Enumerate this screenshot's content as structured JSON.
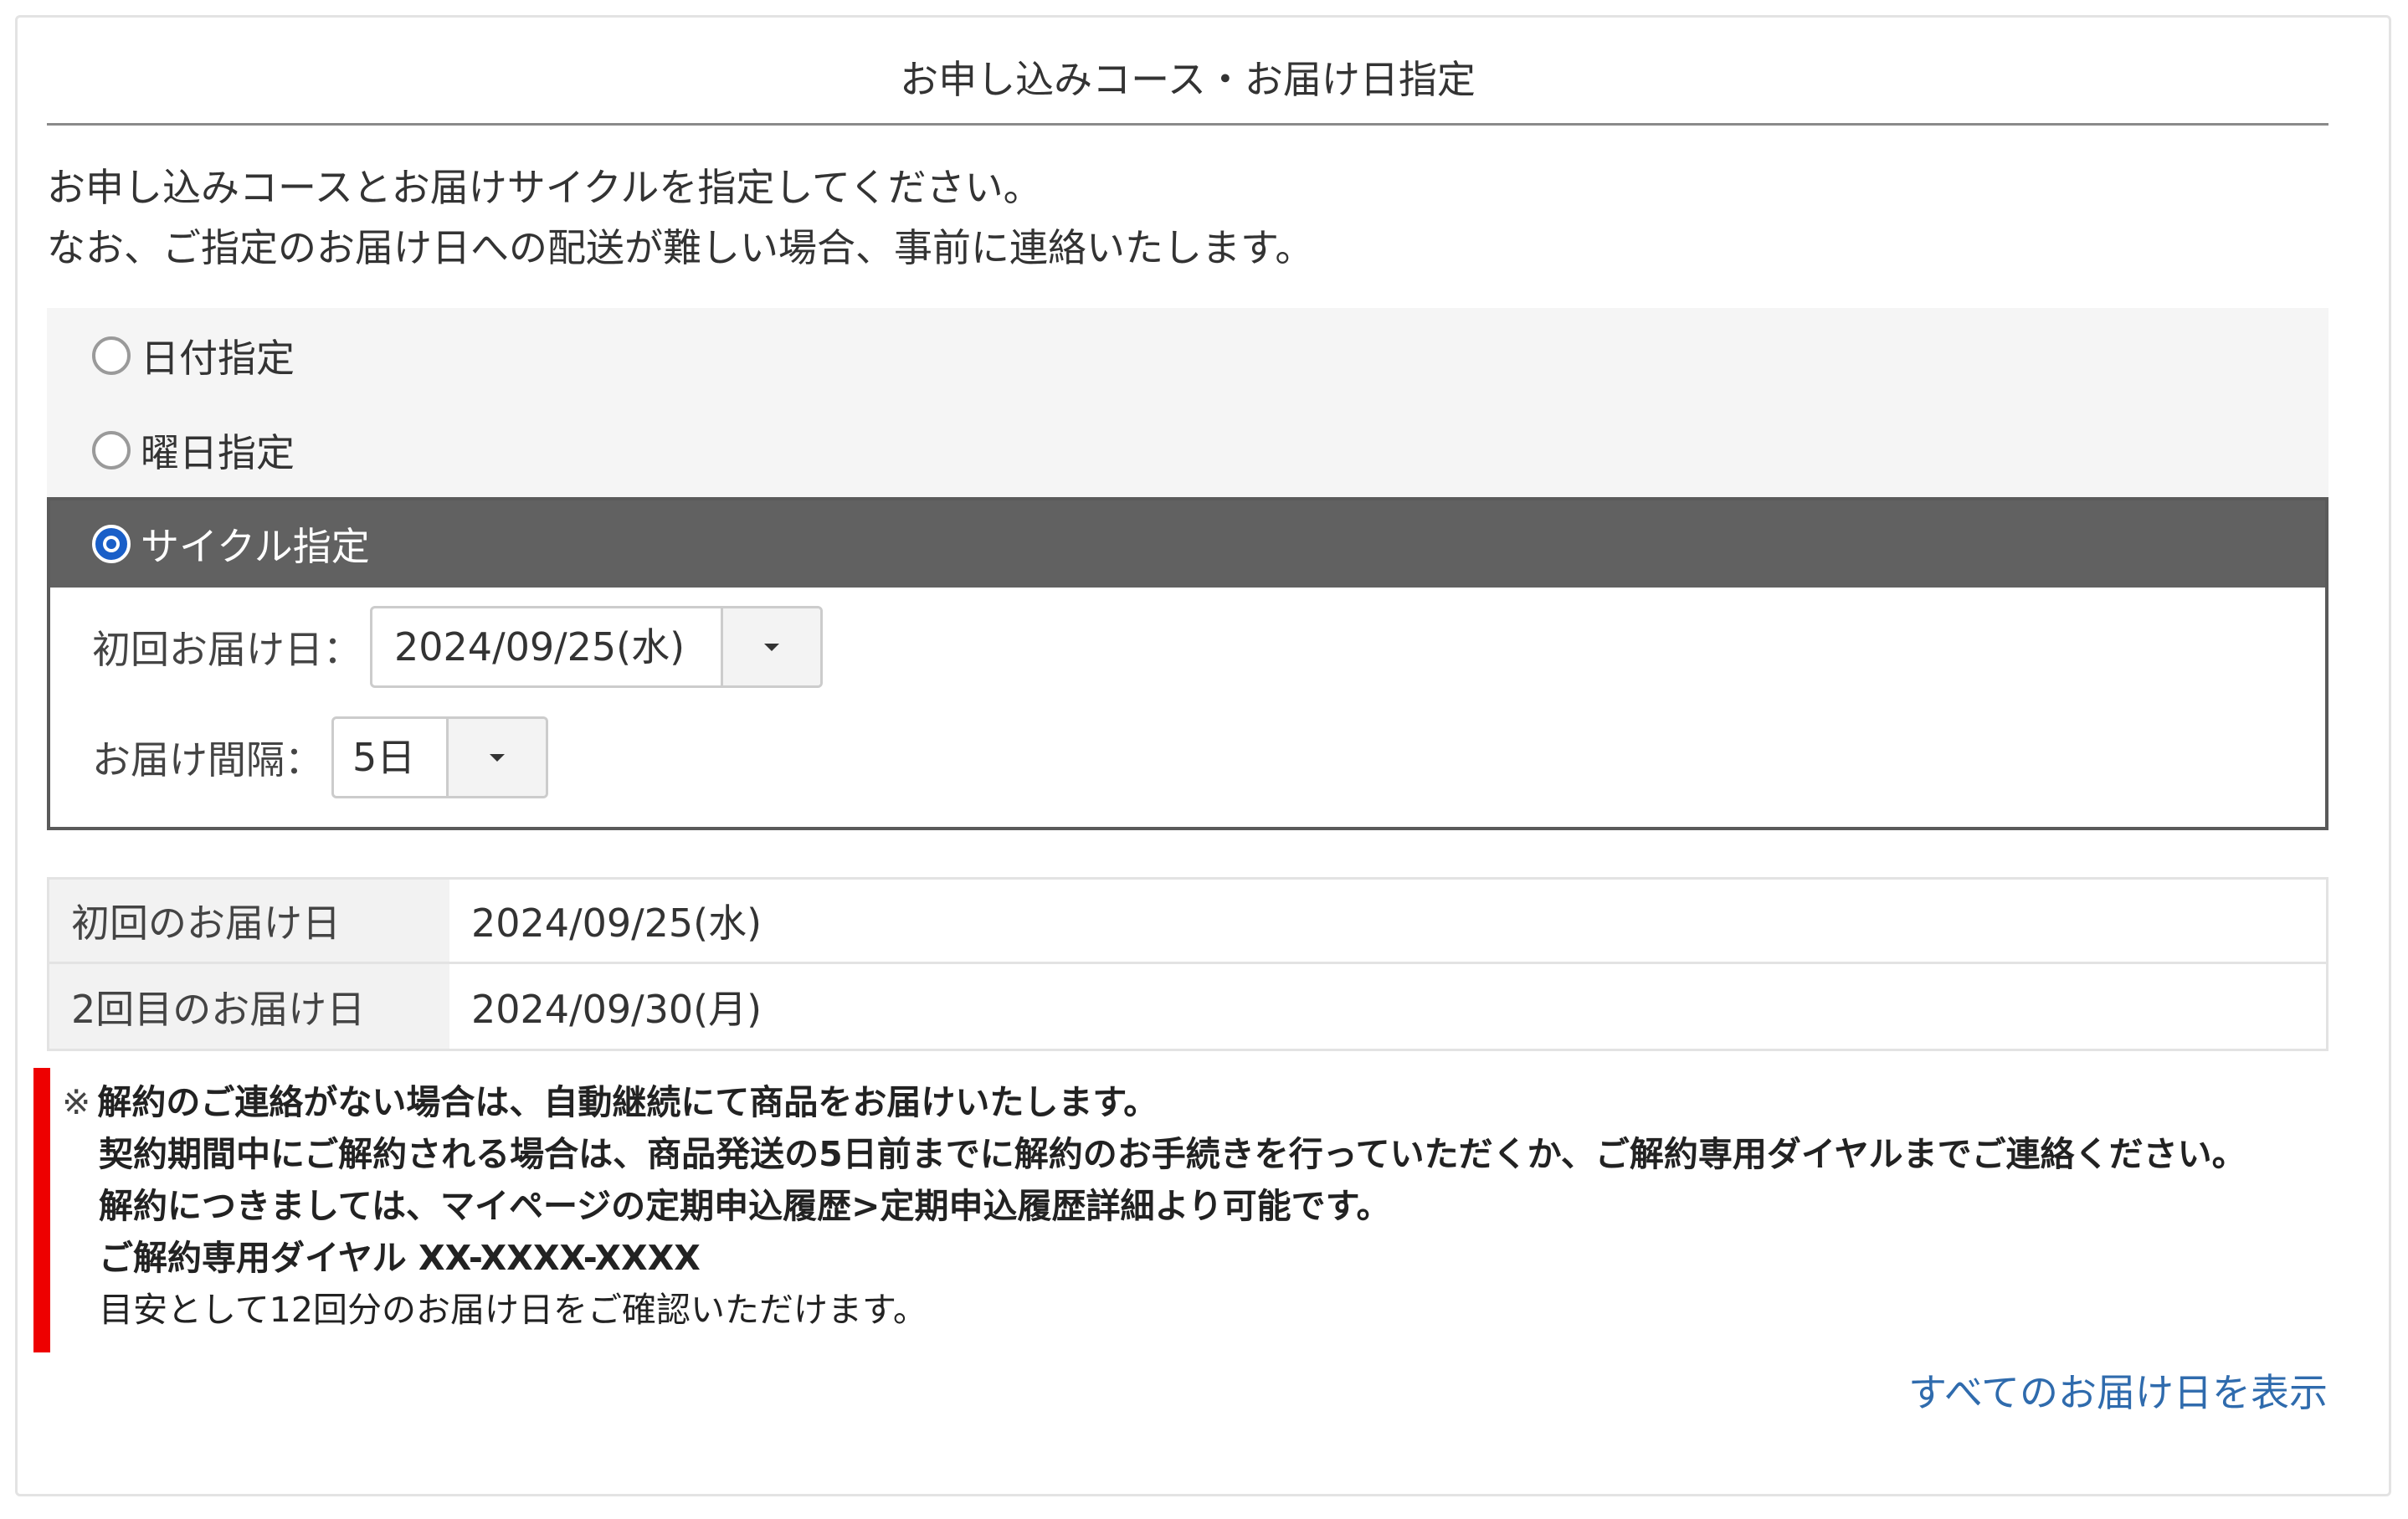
{
  "panel": {
    "title": "お申し込みコース・お届け日指定"
  },
  "intro": {
    "line1": "お申し込みコースとお届けサイクルを指定してください。",
    "line2": "なお、ご指定のお届け日への配送が難しい場合、事前に連絡いたします。"
  },
  "options": {
    "date": {
      "label": "日付指定",
      "checked": false
    },
    "weekday": {
      "label": "曜日指定",
      "checked": false
    },
    "cycle": {
      "label": "サイクル指定",
      "checked": true
    }
  },
  "cycle_fields": {
    "first_delivery": {
      "label": "初回お届け日：",
      "value": "2024/09/25(水)"
    },
    "interval": {
      "label": "お届け間隔：",
      "value": "5日"
    }
  },
  "schedule": {
    "rows": [
      {
        "label": "初回のお届け日",
        "value": "2024/09/25(水)"
      },
      {
        "label": "2回目のお届け日",
        "value": "2024/09/30(月)"
      }
    ]
  },
  "notice": {
    "mark": "※",
    "line1": "解約のご連絡がない場合は、自動継続にて商品をお届けいたします。",
    "line2": "契約期間中にご解約される場合は、商品発送の5日前までに解約のお手続きを行っていただくか、ご解約専用ダイヤルまでご連絡ください。",
    "line3": "解約につきましては、マイページの定期申込履歴>定期申込履歴詳細より可能です。",
    "line4": "ご解約専用ダイヤル XX-XXXX-XXXX",
    "line5": "目安として12回分のお届け日をご確認いただけます。"
  },
  "links": {
    "show_all": "すべてのお届け日を表示"
  },
  "colors": {
    "accent_radio": "#1a5fc8",
    "selected_header": "#616161",
    "notice_bar": "#ee0000",
    "link": "#2f6bad"
  }
}
